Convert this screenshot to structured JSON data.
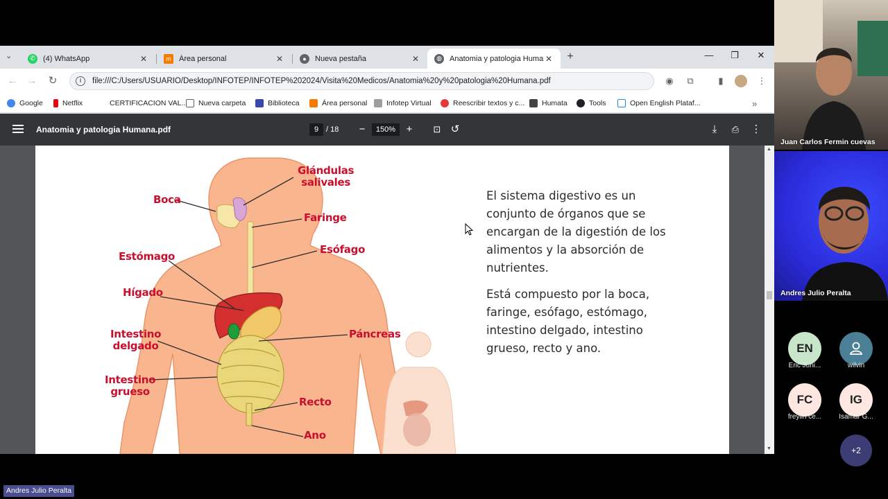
{
  "tabs": [
    {
      "label": "(4) WhatsApp",
      "icon": "whatsapp-icon"
    },
    {
      "label": "Área personal",
      "icon": "moodle-icon"
    },
    {
      "label": "Nueva pestaña",
      "icon": "chrome-icon"
    },
    {
      "label": "Anatomia y patologia Humana.pdf",
      "icon": "globe-icon"
    }
  ],
  "toolbar": {
    "url": "file:///C:/Users/USUARIO/Desktop/INFOTEP/INFOTEP%202024/Visita%20Medicos/Anatomia%20y%20patologia%20Humana.pdf"
  },
  "bookmarks": [
    {
      "label": "Google",
      "color": "#4285f4"
    },
    {
      "label": "Netflix",
      "color": "#e50914"
    },
    {
      "label": "CERTIFICACION VAL...",
      "color": "#ffffff"
    },
    {
      "label": "Nueva carpeta",
      "color": "#5f6368"
    },
    {
      "label": "Biblioteca",
      "color": "#3949ab"
    },
    {
      "label": "Área personal",
      "color": "#f57c00"
    },
    {
      "label": "Infotep Virtual",
      "color": "#9e9e9e"
    },
    {
      "label": "Reescribir textos y c...",
      "color": "#e53935"
    },
    {
      "label": "Humata",
      "color": "#424242"
    },
    {
      "label": "Tools",
      "color": "#202124"
    },
    {
      "label": "Open English Plataf...",
      "color": "#1e88e5"
    }
  ],
  "pdf": {
    "title": "Anatomia y patologia Humana.pdf",
    "current_page": "9",
    "total_pages": "/ 18",
    "zoom": "150%"
  },
  "figure": {
    "labels": {
      "glandulas": "Glándulas\nsalivales",
      "boca": "Boca",
      "faringe": "Faringe",
      "esofago": "Esófago",
      "estomago": "Estómago",
      "higado": "Hígado",
      "pancreas": "Páncreas",
      "intestino_delgado": "Intestino\ndelgado",
      "intestino_grueso": "Intestino\ngrueso",
      "recto": "Recto",
      "ano": "Ano"
    }
  },
  "content": {
    "paragraph1": "El sistema digestivo es un conjunto de órganos que se encargan de la digestión de los alimentos y la absorción de nutrientes.",
    "paragraph2": "Está compuesto por la boca, faringe, esófago, estómago, intestino delgado, intestino grueso, recto y ano."
  },
  "meeting": {
    "video_participants": [
      {
        "name": "Juan Carlos Fermin cuevas"
      },
      {
        "name": "Andres Julio Peralta"
      }
    ],
    "avatars": [
      {
        "initials": "EN",
        "name": "Eric Juni...",
        "color": "#c8e6c9"
      },
      {
        "initials": "",
        "name": "wilvin",
        "color": "#4a7f95"
      },
      {
        "initials": "FC",
        "name": "freylin ce...",
        "color": "#fde7e0"
      },
      {
        "initials": "IG",
        "name": "Isamar G...",
        "color": "#fde7e0"
      }
    ],
    "more_count": "+2",
    "presenter": "Andres Julio Peralta"
  }
}
